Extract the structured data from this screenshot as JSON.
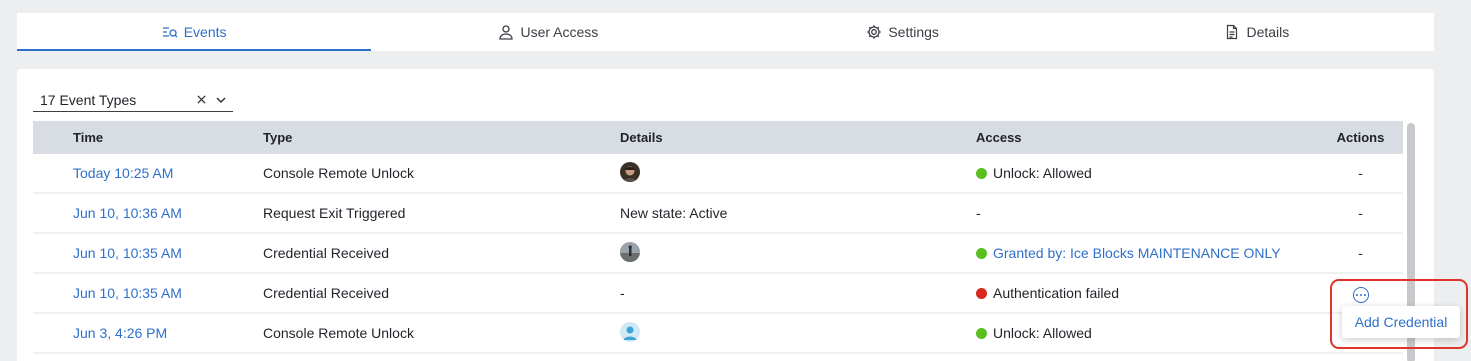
{
  "tabs": [
    {
      "label": "Events",
      "icon": "events-filter-icon",
      "active": true
    },
    {
      "label": "User Access",
      "icon": "user-icon",
      "active": false
    },
    {
      "label": "Settings",
      "icon": "gear-icon",
      "active": false
    },
    {
      "label": "Details",
      "icon": "document-icon",
      "active": false
    }
  ],
  "filter": {
    "value": "17 Event Types"
  },
  "table": {
    "headers": {
      "time": "Time",
      "type": "Type",
      "details": "Details",
      "access": "Access",
      "actions": "Actions"
    },
    "rows": [
      {
        "time": "Today 10:25 AM",
        "type": "Console Remote Unlock",
        "details": "",
        "detail_avatar": "avatar-person",
        "access": "Unlock: Allowed",
        "access_status": "green",
        "access_link": false,
        "actions": "-"
      },
      {
        "time": "Jun 10, 10:36 AM",
        "type": "Request Exit Triggered",
        "details": "New state: Active",
        "access": "-",
        "actions": "-"
      },
      {
        "time": "Jun 10, 10:35 AM",
        "type": "Credential Received",
        "details": "",
        "detail_avatar": "avatar-outdoor",
        "access": "Granted by: Ice Blocks MAINTENANCE ONLY",
        "access_status": "green",
        "access_link": true,
        "actions": "-"
      },
      {
        "time": "Jun 10, 10:35 AM",
        "type": "Credential Received",
        "details": "-",
        "access": "Authentication failed",
        "access_status": "red",
        "access_link": false,
        "actions": "more-icon"
      },
      {
        "time": "Jun 3, 4:26 PM",
        "type": "Console Remote Unlock",
        "details": "",
        "detail_avatar": "avatar-default",
        "access": "Unlock: Allowed",
        "access_status": "green",
        "access_link": false,
        "actions": ""
      }
    ]
  },
  "context_menu": {
    "item": "Add Credential"
  },
  "colors": {
    "accent": "#2f6fc9",
    "allowed": "#5bbf1f",
    "failed": "#d6281b",
    "highlight": "#e0342a"
  }
}
